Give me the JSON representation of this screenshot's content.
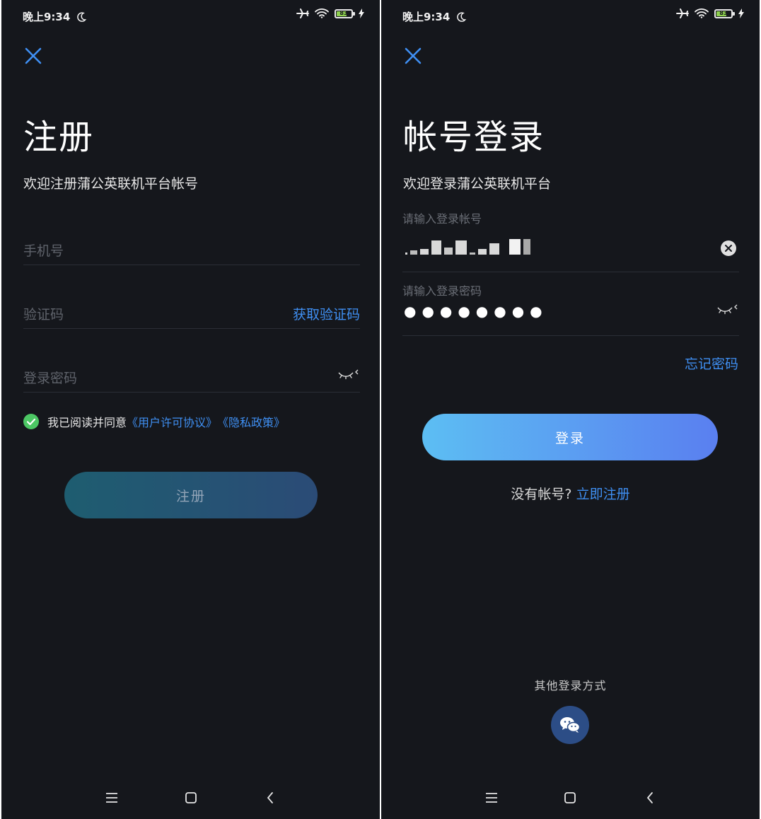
{
  "status_bar": {
    "time": "晚上9:34",
    "battery_level": "83"
  },
  "register": {
    "title": "注册",
    "subtitle": "欢迎注册蒲公英联机平台帐号",
    "phone_placeholder": "手机号",
    "code_placeholder": "验证码",
    "get_code_label": "获取验证码",
    "password_placeholder": "登录密码",
    "agree_text": "我已阅读并同意",
    "user_agreement": "《用户许可协议》",
    "privacy_policy": "《隐私政策》",
    "button_label": "注册"
  },
  "login": {
    "title": "帐号登录",
    "subtitle": "欢迎登录蒲公英联机平台",
    "account_label": "请输入登录帐号",
    "password_label": "请输入登录密码",
    "password_value": "●●●●●●●●",
    "forgot_label": "忘记密码",
    "button_label": "登录",
    "no_account_text": "没有帐号?",
    "register_now": "立即注册",
    "other_login_label": "其他登录方式"
  },
  "icons": {
    "close": "close-icon",
    "eye": "eye-closed-icon",
    "check": "check-circle-icon",
    "clear": "clear-icon",
    "wechat": "wechat-icon",
    "moon": "moon-icon",
    "airplane": "airplane-icon",
    "wifi": "wifi-icon",
    "battery": "battery-icon",
    "charging": "charging-icon",
    "menu": "menu-icon",
    "home": "home-icon",
    "back": "back-icon"
  },
  "colors": {
    "background": "#15171c",
    "link": "#3f8ff2",
    "check": "#4cc764",
    "login_gradient_start": "#5cbef3",
    "login_gradient_end": "#5a7ff0"
  }
}
